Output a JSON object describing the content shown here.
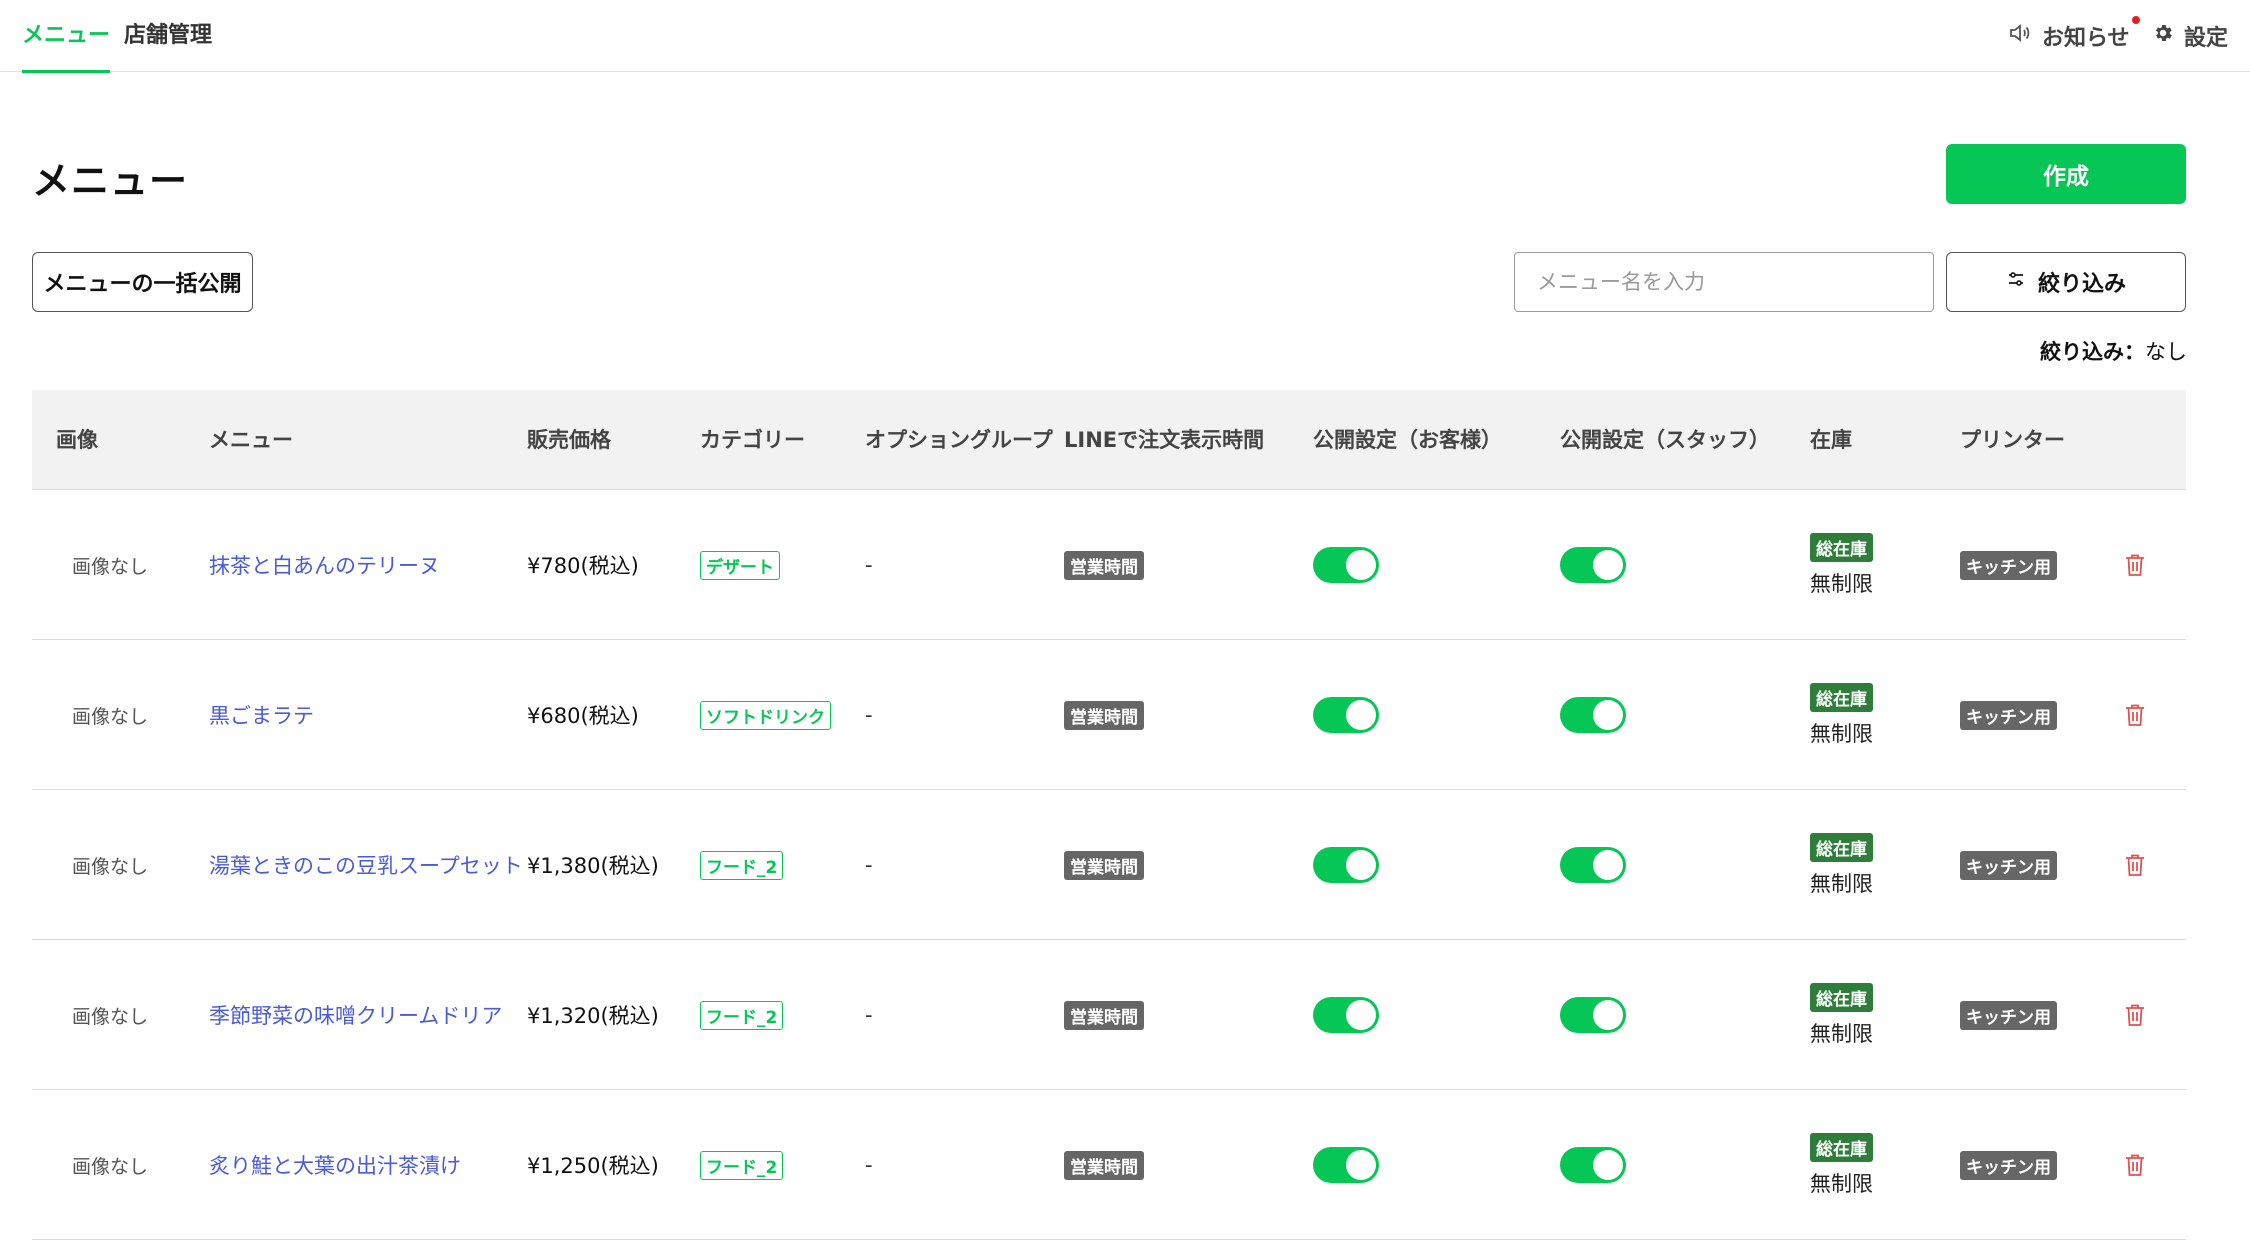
{
  "nav": {
    "tabs": [
      {
        "label": "メニュー",
        "active": true
      },
      {
        "label": "店舗管理",
        "active": false
      }
    ],
    "notice_label": "お知らせ",
    "settings_label": "設定"
  },
  "page": {
    "title": "メニュー",
    "create_label": "作成",
    "bulk_publish_label": "メニューの一括公開",
    "search_placeholder": "メニュー名を入力",
    "filter_label": "絞り込み",
    "filter_status_label": "絞り込み：",
    "filter_status_value": "なし"
  },
  "table": {
    "columns": [
      "画像",
      "メニュー",
      "販売価格",
      "カテゴリー",
      "オプショングループ",
      "LINEで注文表示時間",
      "公開設定（お客様）",
      "公開設定（スタッフ）",
      "在庫",
      "プリンター"
    ],
    "rows": [
      {
        "image": "画像なし",
        "name": "抹茶と白あんのテリーヌ",
        "price": "¥780(税込)",
        "category": "デザート",
        "option_group": "-",
        "display_time": "営業時間",
        "public_customer": true,
        "public_staff": true,
        "stock_badge": "総在庫",
        "stock_value": "無制限",
        "printer": "キッチン用"
      },
      {
        "image": "画像なし",
        "name": "黒ごまラテ",
        "price": "¥680(税込)",
        "category": "ソフトドリンク",
        "option_group": "-",
        "display_time": "営業時間",
        "public_customer": true,
        "public_staff": true,
        "stock_badge": "総在庫",
        "stock_value": "無制限",
        "printer": "キッチン用"
      },
      {
        "image": "画像なし",
        "name": "湯葉ときのこの豆乳スープセット",
        "price": "¥1,380(税込)",
        "category": "フード_2",
        "option_group": "-",
        "display_time": "営業時間",
        "public_customer": true,
        "public_staff": true,
        "stock_badge": "総在庫",
        "stock_value": "無制限",
        "printer": "キッチン用"
      },
      {
        "image": "画像なし",
        "name": "季節野菜の味噌クリームドリア",
        "price": "¥1,320(税込)",
        "category": "フード_2",
        "option_group": "-",
        "display_time": "営業時間",
        "public_customer": true,
        "public_staff": true,
        "stock_badge": "総在庫",
        "stock_value": "無制限",
        "printer": "キッチン用"
      },
      {
        "image": "画像なし",
        "name": "炙り鮭と大葉の出汁茶漬け",
        "price": "¥1,250(税込)",
        "category": "フード_2",
        "option_group": "-",
        "display_time": "営業時間",
        "public_customer": true,
        "public_staff": true,
        "stock_badge": "総在庫",
        "stock_value": "無制限",
        "printer": "キッチン用"
      }
    ]
  },
  "icons": {
    "notice": "speaker-icon",
    "settings": "gear-icon",
    "filter": "sliders-icon",
    "delete": "trash-icon"
  },
  "colors": {
    "accent": "#06c755",
    "link": "#4a5bd6",
    "delete": "#e05050",
    "stock_badge": "#2e7d3a",
    "gray_badge": "#666666"
  }
}
